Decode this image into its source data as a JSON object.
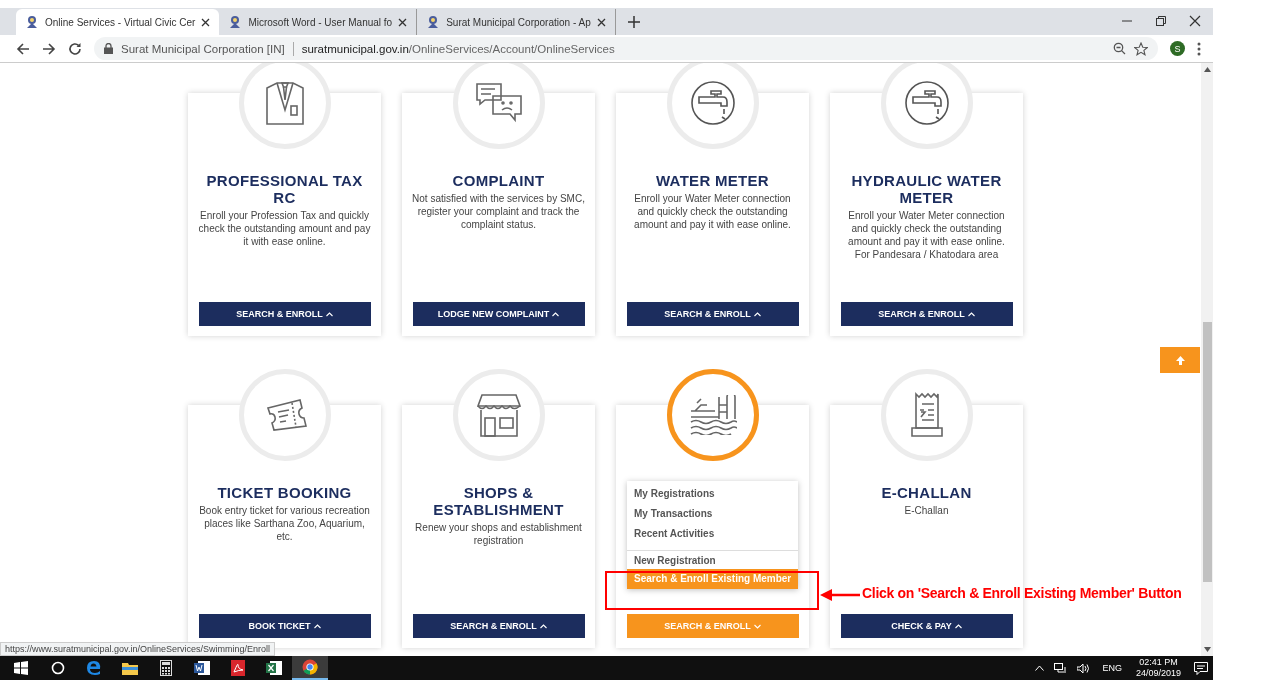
{
  "browser": {
    "tabs": [
      {
        "title": "Online Services - Virtual Civic Cer",
        "selected": true
      },
      {
        "title": "Microsoft Word - User Manual fo",
        "selected": false
      },
      {
        "title": "Surat Municipal Corporation - Ap",
        "selected": false
      }
    ],
    "address": {
      "site_name": "Surat Municipal Corporation [IN]",
      "domain": "suratmunicipal.gov.in",
      "path": "/OnlineServices/Account/OnlineServices"
    },
    "profile_initial": "S"
  },
  "cards": [
    {
      "kind": "suit",
      "title": "PROFESSIONAL TAX RC",
      "description": "Enroll your Profession Tax and quickly check the outstanding amount and pay it with ease online.",
      "button": "SEARCH & ENROLL",
      "expanded": false
    },
    {
      "kind": "chat",
      "title": "COMPLAINT",
      "description": "Not satisfied with the services by SMC, register your complaint and track the complaint status.",
      "button": "LODGE NEW COMPLAINT",
      "expanded": false
    },
    {
      "kind": "tap",
      "title": "WATER METER",
      "description": "Enroll your Water Meter connection and quickly check the outstanding amount and pay it with ease online.",
      "button": "SEARCH & ENROLL",
      "expanded": false
    },
    {
      "kind": "tap",
      "title": "HYDRAULIC WATER METER",
      "description": "Enroll your Water Meter connection and quickly check the outstanding amount and pay it with ease online. For Pandesara / Khatodara area",
      "button": "SEARCH & ENROLL",
      "expanded": false
    },
    {
      "kind": "ticket",
      "title": "TICKET BOOKING",
      "description": "Book entry ticket for various recreation places like Sarthana Zoo, Aquarium, etc.",
      "button": "BOOK TICKET",
      "expanded": false
    },
    {
      "kind": "shop",
      "title": "SHOPS & ESTABLISHMENT",
      "description": "Renew your shops and establishment registration",
      "button": "SEARCH & ENROLL",
      "expanded": false
    },
    {
      "kind": "pool",
      "button": "SEARCH & ENROLL",
      "expanded": true,
      "menu": [
        {
          "label": "My Registrations",
          "selected": false,
          "separator_before": false
        },
        {
          "label": "My Transactions",
          "selected": false,
          "separator_before": false
        },
        {
          "label": "Recent Activities",
          "selected": false,
          "separator_before": false
        },
        {
          "label": "New Registration",
          "selected": false,
          "separator_before": true
        },
        {
          "label": "Search & Enroll Existing Member",
          "selected": true,
          "separator_before": false
        }
      ]
    },
    {
      "kind": "receipt",
      "title": "E-CHALLAN",
      "description": "E-Challan",
      "button": "CHECK & PAY",
      "expanded": false
    }
  ],
  "annotation": "Click on 'Search & Enroll Existing Member' Button",
  "status_url": "https://www.suratmunicipal.gov.in/OnlineServices/Swimming/Enroll",
  "taskbar": {
    "apps": [
      {
        "kind": "search",
        "active": false
      },
      {
        "kind": "edge",
        "active": false
      },
      {
        "kind": "folder",
        "active": false
      },
      {
        "kind": "calculator",
        "active": false
      },
      {
        "kind": "word",
        "active": false
      },
      {
        "kind": "pdf",
        "active": false
      },
      {
        "kind": "excel",
        "active": false
      },
      {
        "kind": "chrome",
        "active": true
      }
    ],
    "language": "ENG",
    "time": "02:41 PM",
    "date": "24/09/2019"
  }
}
